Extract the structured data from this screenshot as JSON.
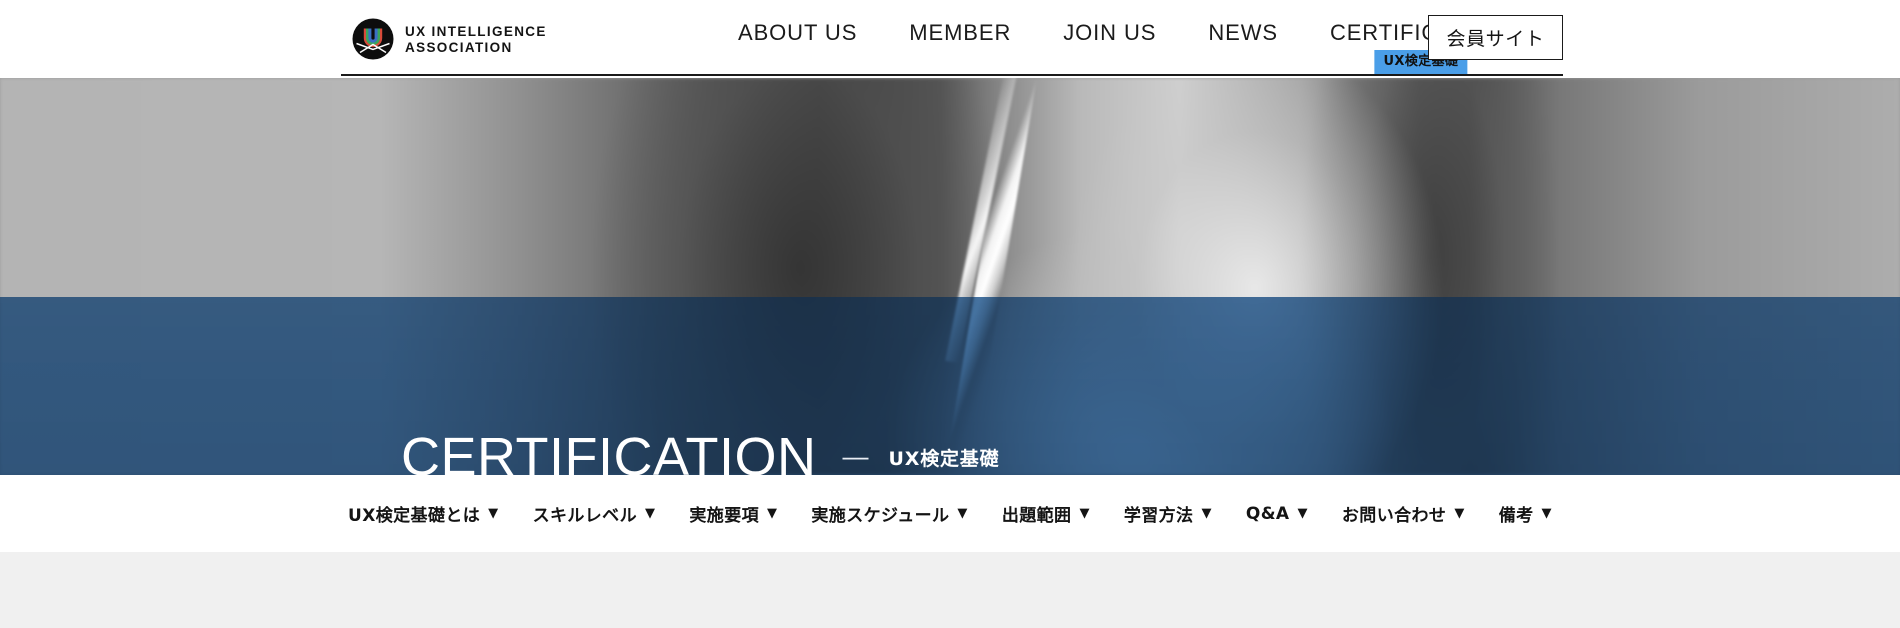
{
  "header": {
    "logo": {
      "icon": "uxia-circle-logo",
      "line1": "UX INTELLIGENCE",
      "line2": "ASSOCIATION"
    },
    "nav": [
      {
        "label": "ABOUT US",
        "badge": null
      },
      {
        "label": "MEMBER",
        "badge": null
      },
      {
        "label": "JOIN US",
        "badge": null
      },
      {
        "label": "NEWS",
        "badge": null
      },
      {
        "label": "CERTIFICATION",
        "badge": "UX検定基礎"
      }
    ],
    "member_button": {
      "label": "会員サイト"
    }
  },
  "hero": {
    "title": "CERTIFICATION",
    "separator": "—",
    "subtitle": "UX検定基礎",
    "image_alt": "grayscale photo of a hand writing with a pen",
    "overlay_color": "#3a6ea0",
    "badge_color": "#4a9ee8"
  },
  "subnav": {
    "items": [
      {
        "label": "UX検定基礎とは",
        "caret": "▼"
      },
      {
        "label": "スキルレベル",
        "caret": "▼"
      },
      {
        "label": "実施要項",
        "caret": "▼"
      },
      {
        "label": "実施スケジュール",
        "caret": "▼"
      },
      {
        "label": "出題範囲",
        "caret": "▼"
      },
      {
        "label": "学習方法",
        "caret": "▼"
      },
      {
        "label": "Q&A",
        "caret": "▼"
      },
      {
        "label": "お問い合わせ",
        "caret": "▼"
      },
      {
        "label": "備考",
        "caret": "▼"
      }
    ]
  }
}
